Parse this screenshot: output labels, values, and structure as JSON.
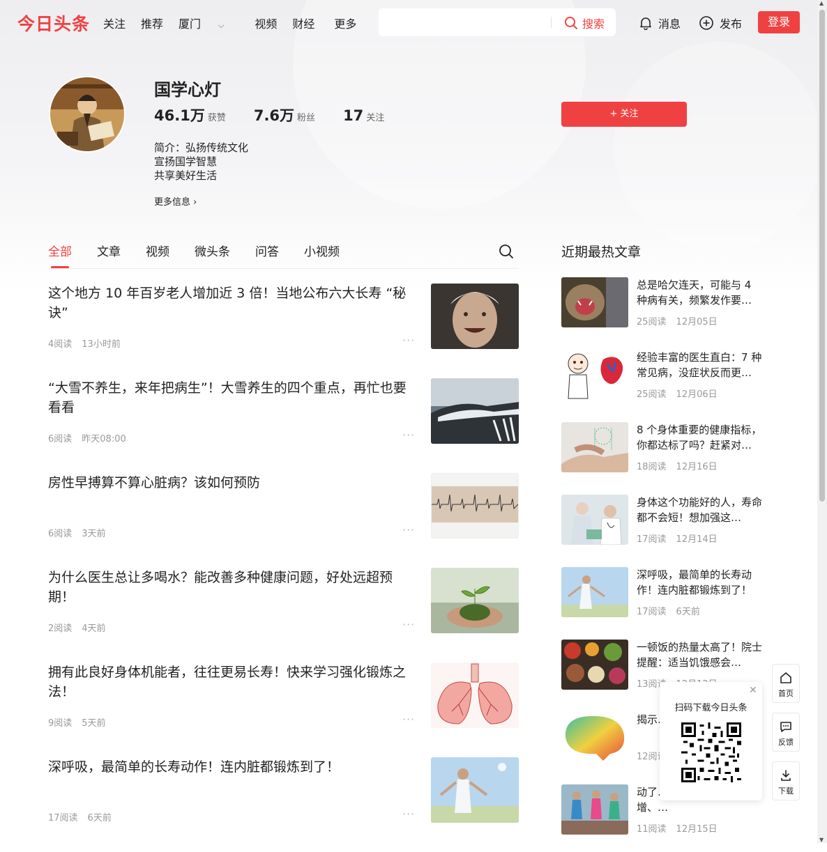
{
  "header": {
    "logo": "今日头条",
    "nav": [
      "关注",
      "推荐",
      "厦门",
      "视频",
      "财经",
      "更多"
    ],
    "search": {
      "placeholder": "",
      "button_label": "搜索"
    },
    "messages_label": "消息",
    "publish_label": "发布",
    "login_label": "登录"
  },
  "profile": {
    "name": "国学心灯",
    "likes_count": "46.1万",
    "likes_label": "获赞",
    "fans_count": "7.6万",
    "fans_label": "粉丝",
    "following_count": "17",
    "following_label": "关注",
    "bio": [
      "简介：弘扬传统文化",
      "宣扬国学智慧",
      "共享美好生活"
    ],
    "more_info_label": "更多信息",
    "follow_button_label": "+ 关注"
  },
  "tabs": [
    "全部",
    "文章",
    "视频",
    "微头条",
    "问答",
    "小视频"
  ],
  "feed": [
    {
      "title": "这个地方 10 年百岁老人增加近 3 倍！当地公布六大长寿 “秘诀”",
      "reads": "4阅读",
      "time": "13小时前",
      "thumb": "elderly-woman-photo"
    },
    {
      "title": "“大雪不养生，来年把病生”！大雪养生的四个重点，再忙也要看看",
      "reads": "6阅读",
      "time": "昨天08:00",
      "thumb": "snowy-car-photo"
    },
    {
      "title": "房性早搏算不算心脏病？该如何预防",
      "reads": "6阅读",
      "time": "3天前",
      "thumb": "ecg-paper-photo"
    },
    {
      "title": "为什么医生总让多喝水？能改善多种健康问题，好处远超预期！",
      "reads": "2阅读",
      "time": "4天前",
      "thumb": "plant-in-hands-photo"
    },
    {
      "title": "拥有此良好身体机能者，往往更易长寿！快来学习强化锻炼之法！",
      "reads": "9阅读",
      "time": "5天前",
      "thumb": "lungs-illustration"
    },
    {
      "title": "深呼吸，最简单的长寿动作！连内脏都锻炼到了！",
      "reads": "17阅读",
      "time": "6天前",
      "thumb": "woman-breathing-photo"
    }
  ],
  "hot_title": "近期最热文章",
  "hot_articles": [
    {
      "title": "总是哈欠连天，可能与 4 种病有关，频繁发作要…",
      "reads": "25阅读",
      "date": "12月05日",
      "thumb": "yawning-cat-photo"
    },
    {
      "title": "经验丰富的医生直白：7 种常见病，没症状反而更…",
      "reads": "25阅读",
      "date": "12月06日",
      "thumb": "cartoon-doctor-heart"
    },
    {
      "title": "8 个身体重要的健康指标，你都达标了吗？赶紧对…",
      "reads": "18阅读",
      "date": "12月16日",
      "thumb": "health-hands-photo"
    },
    {
      "title": "身体这个功能好的人，寿命都不会短！想加强这…",
      "reads": "17阅读",
      "date": "12月14日",
      "thumb": "doctor-elderly-photo"
    },
    {
      "title": "深呼吸，最简单的长寿动作！连内脏都锻炼到了！",
      "reads": "17阅读",
      "date": "6天前",
      "thumb": "woman-breathing-photo"
    },
    {
      "title": "一顿饭的热量太高了！院士提醒：适当饥饿感会…",
      "reads": "13阅读",
      "date": "12月12日",
      "thumb": "food-variety-photo"
    },
    {
      "title": "揭示…前尤…",
      "reads": "12阅读",
      "date": "",
      "thumb": "brain-colorful"
    },
    {
      "title": "动了…运动的人，体能不增、…",
      "reads": "11阅读",
      "date": "12月15日",
      "thumb": "running-family-photo"
    }
  ],
  "qr_popup": {
    "label": "扫码下载今日头条"
  },
  "side_tools": {
    "home_label": "首页",
    "feedback_label": "反馈",
    "download_label": "下载"
  },
  "colors": {
    "brand_red": "#f04142",
    "meta_gray": "#999999"
  }
}
